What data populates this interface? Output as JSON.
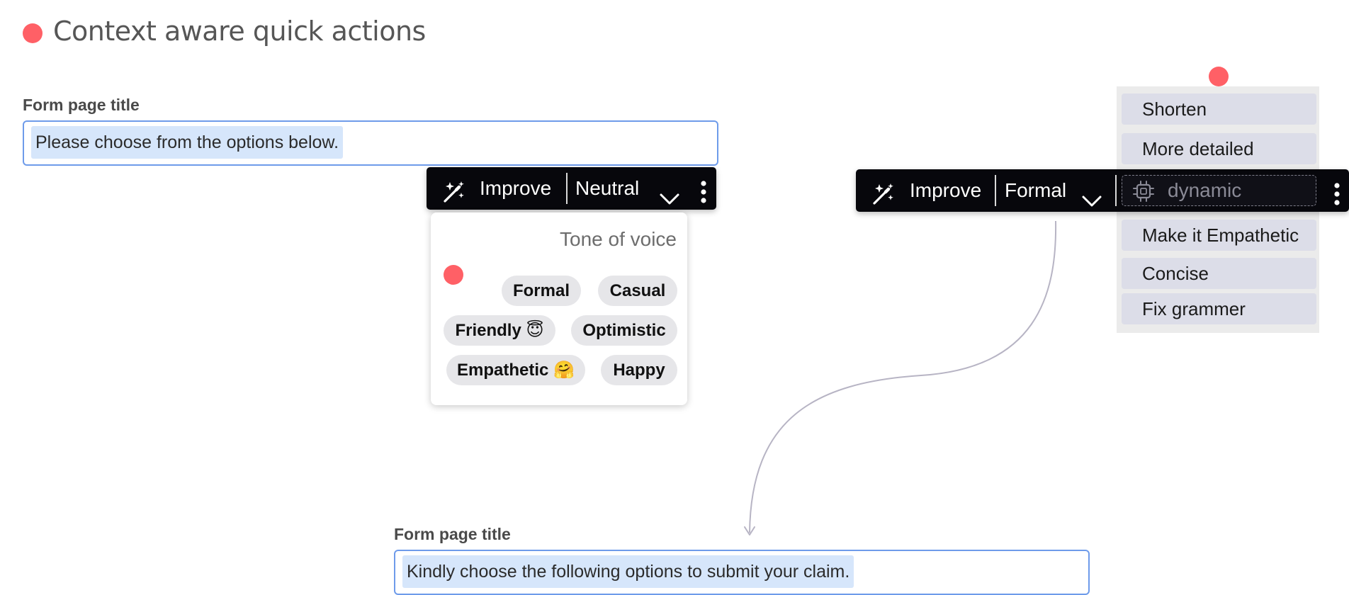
{
  "colors": {
    "accent_dot": "#ff6066",
    "input_border": "#6e9bea",
    "selection": "#d6e6fb",
    "toolbar_bg": "#07070c"
  },
  "page": {
    "heading": "Context aware quick actions"
  },
  "field_top": {
    "label": "Form page title",
    "value": "Please choose from the options below."
  },
  "toolbar_left": {
    "improve_label": "Improve",
    "tone_value": "Neutral",
    "icons": [
      "magic-wand-icon",
      "chevron-down-icon",
      "more-vertical-icon"
    ]
  },
  "tone_panel": {
    "title": "Tone of voice",
    "options": [
      "Formal",
      "Casual",
      "Friendly 😇",
      "Optimistic",
      "Empathetic 🤗",
      "Happy"
    ]
  },
  "toolbar_right": {
    "improve_label": "Improve",
    "tone_value": "Formal",
    "dynamic_label": "dynamic",
    "icons": [
      "magic-wand-icon",
      "chevron-down-icon",
      "chip-icon",
      "more-vertical-icon"
    ]
  },
  "quick_actions": {
    "items": [
      "Shorten",
      "More detailed",
      "Make it Empathetic",
      "Concise",
      "Fix grammer"
    ]
  },
  "field_bottom": {
    "label": "Form page title",
    "value": "Kindly choose the following options to submit your claim."
  }
}
